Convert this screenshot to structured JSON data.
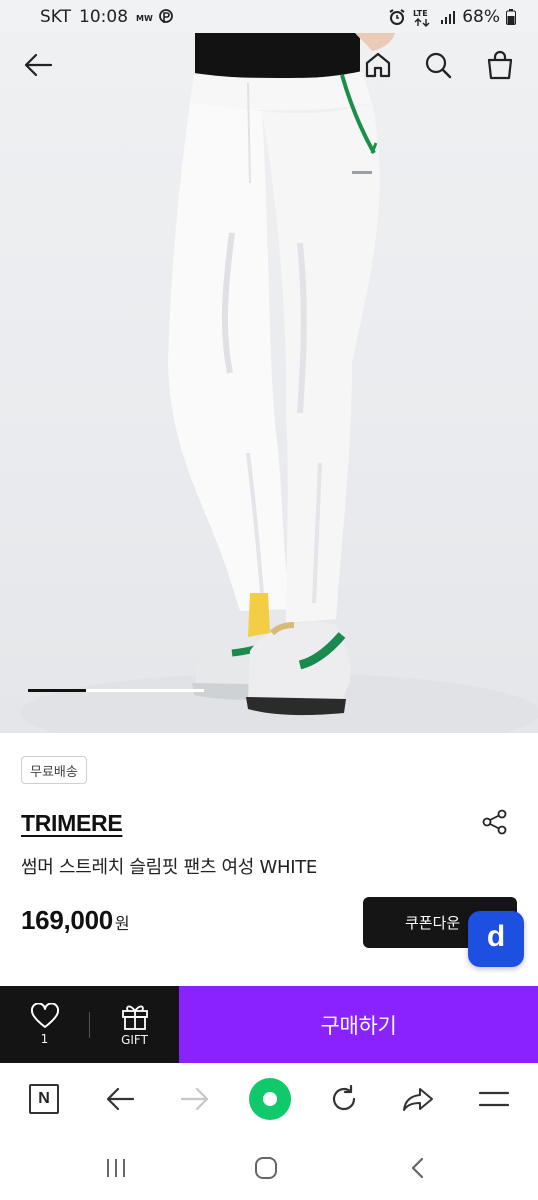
{
  "status_bar": {
    "carrier": "SKT",
    "time": "10:08",
    "network": "LTE",
    "battery": "68%",
    "icons": [
      "alarm-icon",
      "lte-icon",
      "signal-icon",
      "battery-icon"
    ]
  },
  "top_nav": {
    "back_icon": "arrow-left-icon",
    "home_icon": "home-icon",
    "search_icon": "search-icon",
    "cart_icon": "shopping-bag-icon"
  },
  "gallery": {
    "image_alt": "white slim pants with green trim and sneakers",
    "current_position": 0.33
  },
  "product": {
    "badge": "무료배송",
    "brand": "TRIMERE",
    "name": "썸머 스트레치 슬림핏 팬츠 여성 WHITE",
    "price": "169,000",
    "currency": "원",
    "coupon_label": "쿠폰다운",
    "fab_letter": "d"
  },
  "action_bar": {
    "like_count": "1",
    "gift_label": "GIFT",
    "buy_label": "구매하기",
    "buy_color": "#8a22ff"
  },
  "browser_bar": {
    "n_label": "N",
    "icons": [
      "naver-n-icon",
      "back-icon",
      "forward-icon",
      "green-dot-icon",
      "refresh-icon",
      "share-icon",
      "menu-icon"
    ]
  },
  "system_nav": {
    "icons": [
      "recent-apps-icon",
      "home-circle-icon",
      "back-chevron-icon"
    ]
  }
}
